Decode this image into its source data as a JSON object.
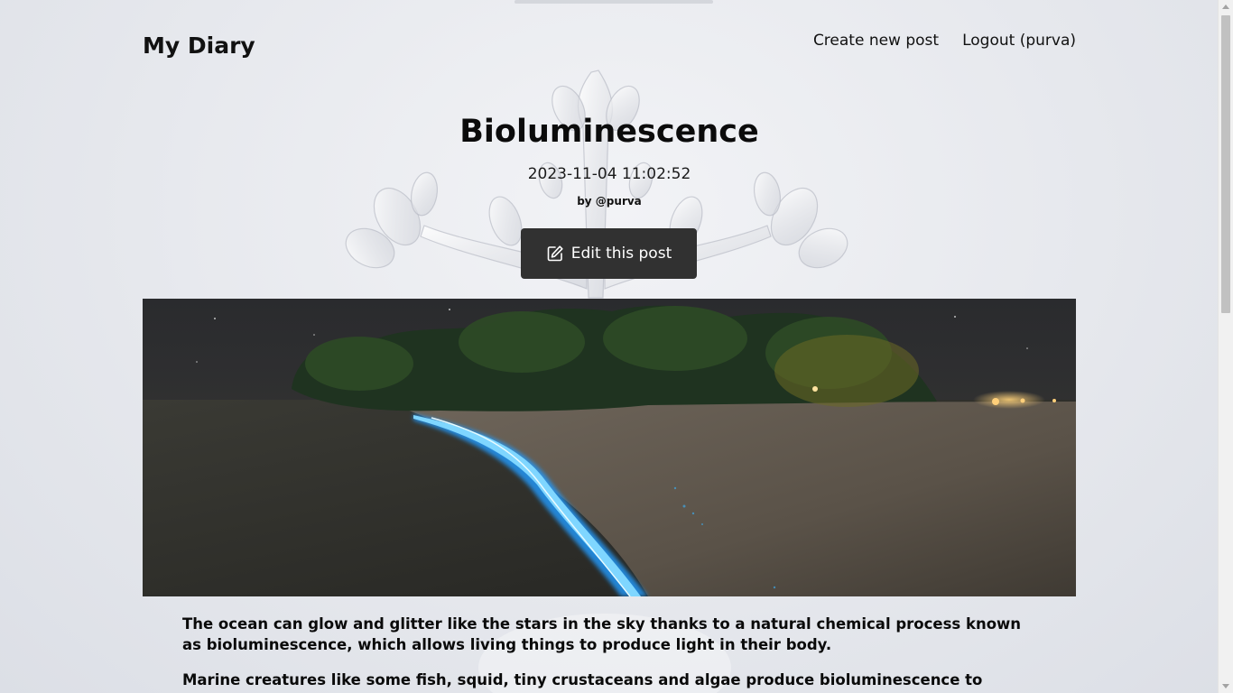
{
  "header": {
    "brand": "My Diary",
    "nav": {
      "create": "Create new post",
      "logout": "Logout (purva)"
    }
  },
  "post": {
    "title": "Bioluminescence",
    "date": "2023-11-04 11:02:52",
    "author": "by @purva",
    "edit_label": "Edit this post",
    "paragraphs": [
      "The ocean can glow and glitter like the stars in the sky thanks to a natural chemical process known as bioluminescence, which allows living things to produce light in their body.",
      "Marine creatures like some fish, squid, tiny crustaceans and algae produce bioluminescence to either confuse"
    ]
  },
  "icons": {
    "edit": "edit-pencil-square-icon"
  },
  "colors": {
    "button_bg": "#313131",
    "button_text": "#ffffff",
    "text": "#111111"
  }
}
